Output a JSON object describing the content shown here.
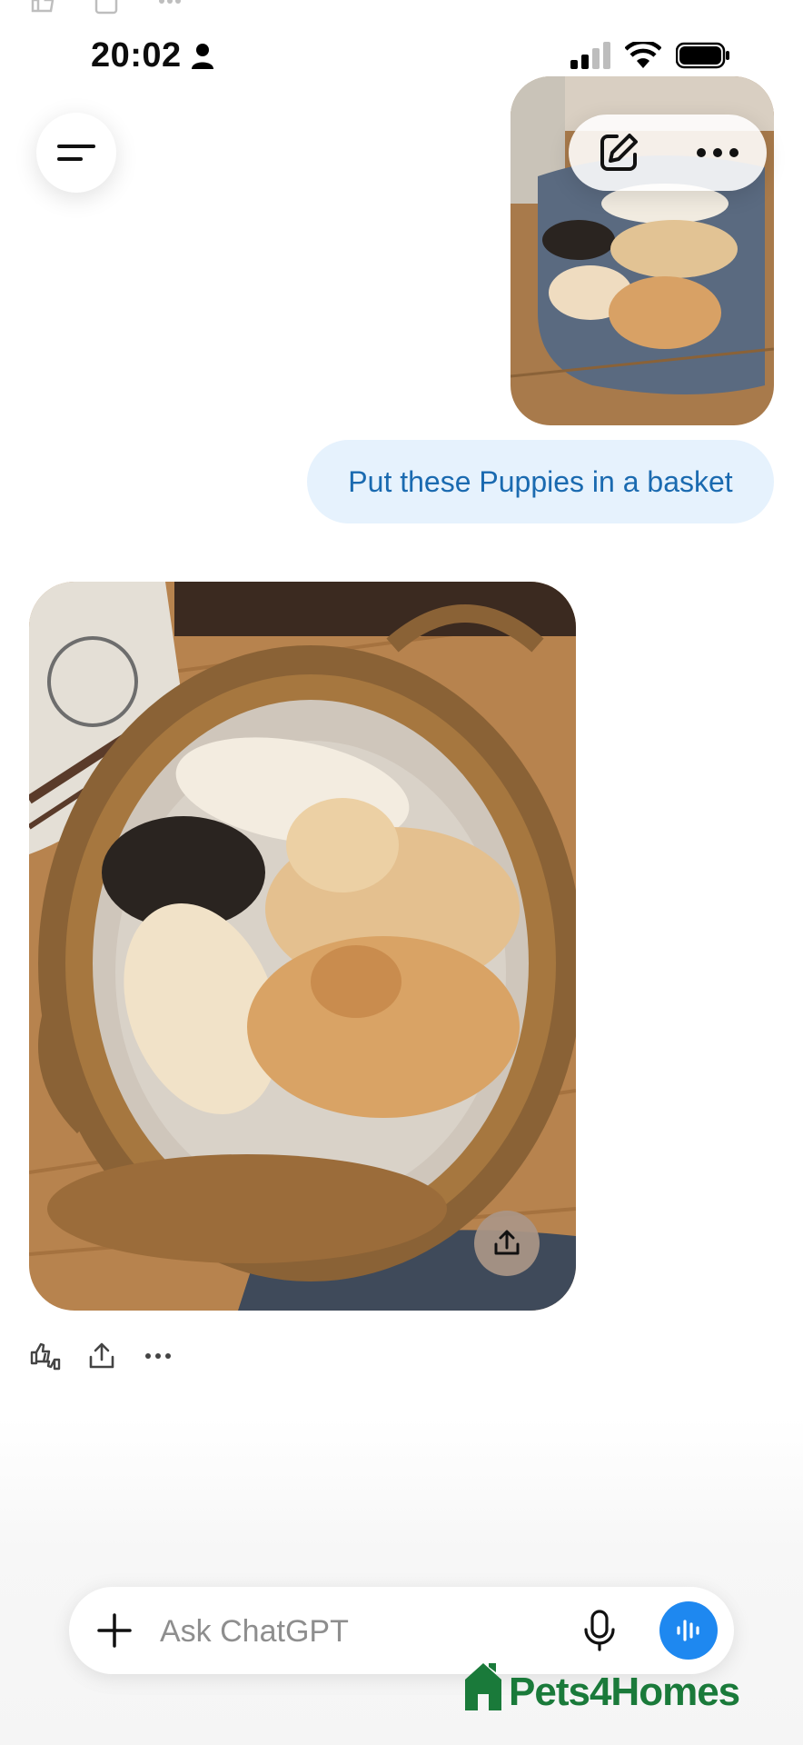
{
  "status_bar": {
    "time": "20:02",
    "icons": [
      "person-icon",
      "cellular-signal-icon",
      "wifi-icon",
      "battery-icon"
    ]
  },
  "header": {
    "icons": [
      "menu-icon",
      "new-chat-icon",
      "more-options-icon"
    ]
  },
  "conversation": {
    "user_message": "Put these Puppies in a basket",
    "assistant_actions": [
      "thumbs-up-down-icon",
      "share-icon",
      "more-icon"
    ],
    "image_overlay_icon": "share-icon"
  },
  "composer": {
    "placeholder": "Ask ChatGPT",
    "icons": [
      "plus-icon",
      "microphone-icon",
      "voice-mode-icon"
    ]
  },
  "watermark": {
    "text": "Pets4Homes"
  },
  "colors": {
    "bubble_bg": "#e6f2fd",
    "bubble_text": "#1a6ab0",
    "voice_button": "#1e88f0",
    "watermark": "#1a7a3a"
  }
}
